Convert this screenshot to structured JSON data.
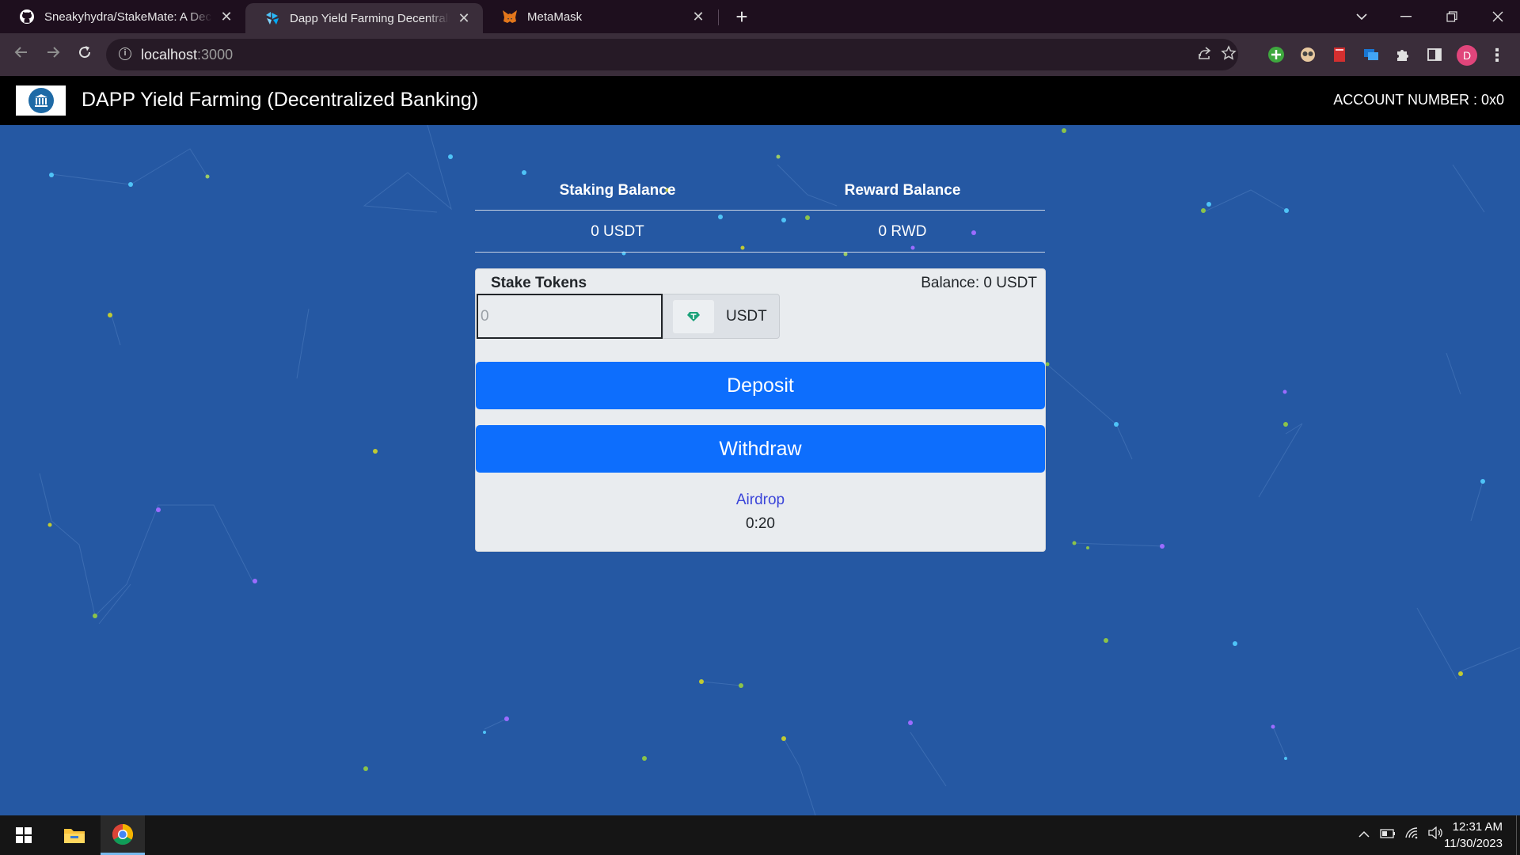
{
  "browser": {
    "tabs": [
      {
        "title": "Sneakyhydra/StakeMate: A Decentralized Staking App",
        "icon": "github-icon",
        "active": false
      },
      {
        "title": "Dapp Yield Farming Decentralized Banking",
        "icon": "dapp-logo-icon",
        "active": true
      },
      {
        "title": "MetaMask",
        "icon": "metamask-fox-icon",
        "active": false
      }
    ],
    "address": {
      "host": "localhost",
      "port": ":3000"
    }
  },
  "app": {
    "title": "DAPP Yield Farming (Decentralized Banking)",
    "account_label": "ACCOUNT NUMBER : 0x0"
  },
  "balances": {
    "staking_header": "Staking Balance",
    "reward_header": "Reward Balance",
    "staking_value": "0 USDT",
    "reward_value": "0 RWD"
  },
  "stake_card": {
    "label": "Stake Tokens",
    "balance_text": "Balance: 0 USDT",
    "input_placeholder": "0",
    "token_label": "USDT",
    "deposit_label": "Deposit",
    "withdraw_label": "Withdraw",
    "airdrop_label": "Airdrop",
    "timer": "0:20"
  },
  "taskbar": {
    "time": "12:31 AM",
    "date": "11/30/2023"
  },
  "colors": {
    "background": "#2558a3",
    "primary_button": "#0d6efd",
    "navbar": "#000000",
    "card": "#e9ecef"
  }
}
